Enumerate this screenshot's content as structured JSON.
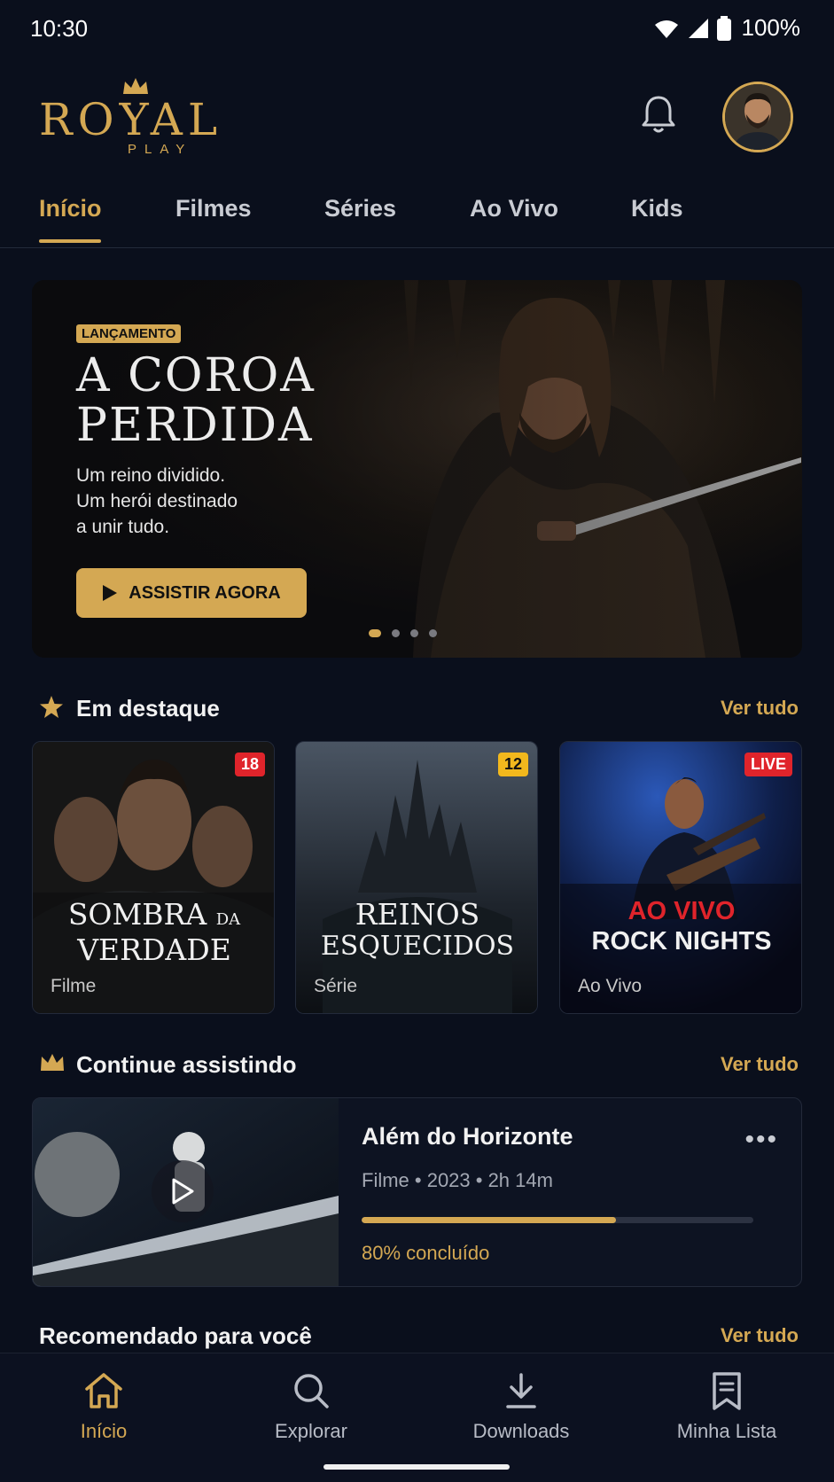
{
  "status_bar": {
    "time": "10:30",
    "battery": "100%"
  },
  "app": {
    "logo_text": "ROYAL",
    "logo_sub": "PLAY",
    "accent": "#d4a853"
  },
  "tabs": [
    {
      "label": "Início",
      "active": true
    },
    {
      "label": "Filmes"
    },
    {
      "label": "Séries"
    },
    {
      "label": "Ao Vivo"
    },
    {
      "label": "Kids"
    }
  ],
  "hero": {
    "badge": "LANÇAMENTO",
    "title_line1": "A COROA",
    "title_line2": "PERDIDA",
    "desc_line1": "Um reino dividido.",
    "desc_line2": "Um herói destinado",
    "desc_line3": "a unir tudo.",
    "cta": "ASSISTIR AGORA",
    "slides": 4,
    "active_slide": 1
  },
  "featured": {
    "title": "Em destaque",
    "see_all": "Ver tudo",
    "items": [
      {
        "title_a": "SOMBRA",
        "title_small": "DA",
        "title_b": "VERDADE",
        "type": "Filme",
        "rating": "18",
        "rating_color": "#e0242b"
      },
      {
        "title_a": "REINOS",
        "title_b": "ESQUECIDOS",
        "type": "Série",
        "rating": "12",
        "rating_color": "#f2b81d"
      },
      {
        "title_a": "AO VIVO",
        "title_b": "ROCK NIGHTS",
        "type": "Ao Vivo",
        "rating": "LIVE",
        "rating_color": "#e0242b"
      }
    ]
  },
  "continue": {
    "title": "Continue assistindo",
    "see_all": "Ver tudo",
    "item": {
      "title": "Além do Horizonte",
      "meta": "Filme • 2023 • 2h 14m",
      "progress": 0.65,
      "progress_label": "80% concluído"
    }
  },
  "recommended": {
    "title": "Recomendado para você",
    "see_all": "Ver tudo"
  },
  "bottom_nav": [
    {
      "label": "Início",
      "icon": "home-icon",
      "active": true
    },
    {
      "label": "Explorar",
      "icon": "search-icon"
    },
    {
      "label": "Downloads",
      "icon": "download-icon"
    },
    {
      "label": "Minha Lista",
      "icon": "bookmark-list-icon"
    }
  ]
}
